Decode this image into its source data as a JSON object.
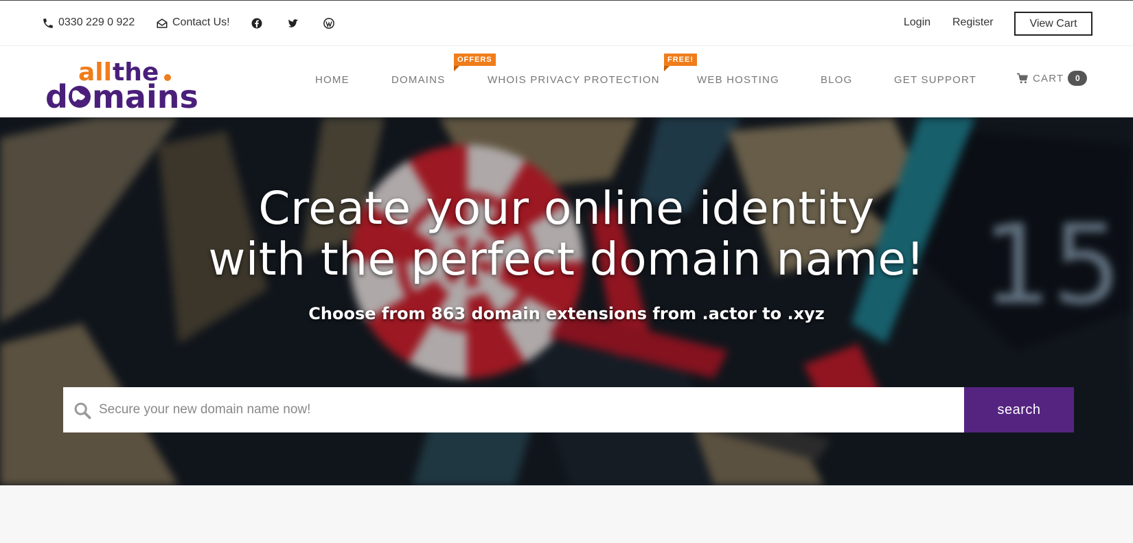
{
  "topbar": {
    "phone": "0330 229 0 922",
    "contact": "Contact Us!",
    "login": "Login",
    "register": "Register",
    "view_cart": "View Cart",
    "social_icons": [
      "facebook-icon",
      "twitter-icon",
      "wordpress-icon"
    ]
  },
  "logo": {
    "line1": "allthe",
    "line2": "domains",
    "colors": {
      "orange": "#f07d1a",
      "purple": "#4a1f7a"
    }
  },
  "nav": {
    "items": [
      {
        "label": "HOME"
      },
      {
        "label": "DOMAINS",
        "badge": "OFFERS"
      },
      {
        "label": "WHOIS PRIVACY PROTECTION",
        "badge": "FREE!"
      },
      {
        "label": "WEB HOSTING"
      },
      {
        "label": "BLOG"
      },
      {
        "label": "GET SUPPORT"
      }
    ],
    "cart_label": "CART",
    "cart_count": "0"
  },
  "hero": {
    "title_line1": "Create your online identity",
    "title_line2": "with the perfect domain name!",
    "subtitle": "Choose from 863 domain extensions from .actor to .xyz",
    "dartboard_number": "15"
  },
  "search": {
    "placeholder": "Secure your new domain name now!",
    "value": "",
    "button_label": "search"
  },
  "colors": {
    "accent_purple": "#552481",
    "badge_orange": "#f07d1a",
    "nav_text": "#777777"
  }
}
